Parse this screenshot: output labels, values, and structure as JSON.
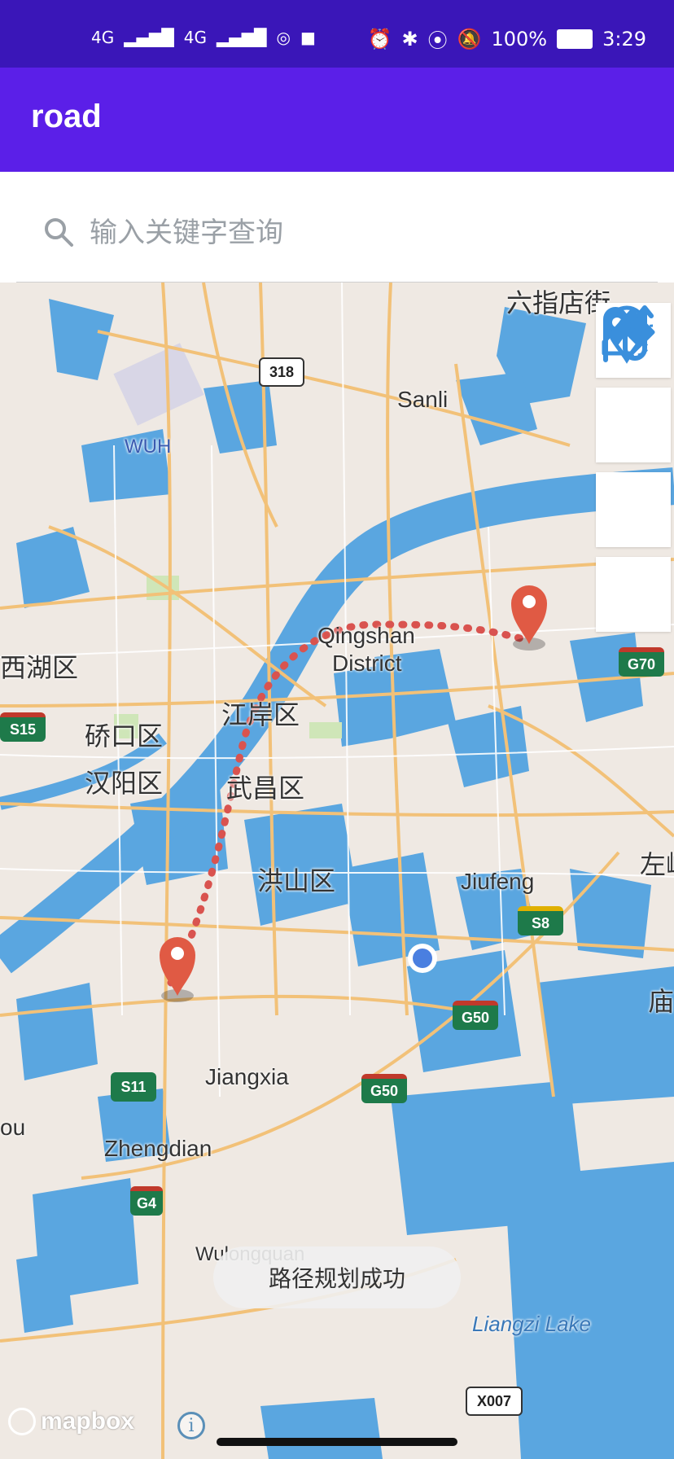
{
  "status_bar": {
    "signal1": "4G",
    "signal2": "4G",
    "battery": "100%",
    "time": "3:29"
  },
  "app": {
    "title": "road"
  },
  "search": {
    "placeholder": "输入关键字查询"
  },
  "map": {
    "labels": {
      "liuzhidianjie": "六指店街",
      "sanli": "Sanli",
      "wuh": "WUH",
      "qingshan": "Qingshan",
      "district": "District",
      "xihuqu": "西湖区",
      "jianganqu": "江岸区",
      "qiaokouqu": "硚口区",
      "hanyangqu": "汉阳区",
      "wuchangqu": "武昌区",
      "hongshanqu": "洪山区",
      "jiufeng": "Jiufeng",
      "zuo": "左岭",
      "miao": "庙",
      "jiangxia": "Jiangxia",
      "zhengdian": "Zhengdian",
      "ou": "ou",
      "wulongquan": "Wulongquan",
      "liangzi": "Liangzi Lake"
    },
    "shields": {
      "r318": "318",
      "g70": "G70",
      "s15": "S15",
      "s8": "S8",
      "g50a": "G50",
      "g50b": "G50",
      "s11": "S11",
      "g4": "G4",
      "x007": "X007"
    },
    "attribution": "mapbox",
    "info": "i"
  },
  "toast": {
    "message": "路径规划成功"
  },
  "colors": {
    "status_bar": "#3a16b8",
    "app_bar": "#5b1fe8",
    "route": "#d9534f",
    "water": "#5aa6e0",
    "tool_icon": "#3a8fdc"
  },
  "tools": [
    "route-icon",
    "eraser-icon",
    "location-pin-icon",
    "path-icon"
  ]
}
